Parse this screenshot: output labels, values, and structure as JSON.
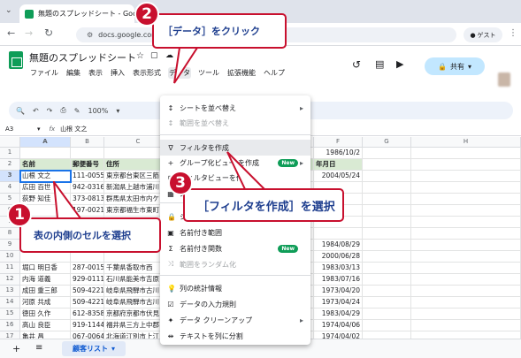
{
  "browser": {
    "tab_title": "無題のスプレッドシート - Google スプ",
    "url": "docs.google.com/sprea",
    "guest": "ゲスト"
  },
  "doc": {
    "title": "無題のスプレッドシート",
    "menus": [
      "ファイル",
      "編集",
      "表示",
      "挿入",
      "表示形式",
      "データ",
      "ツール",
      "拡張機能",
      "ヘルプ"
    ],
    "share": "共有"
  },
  "toolbar": {
    "zoom": "100%"
  },
  "formula": {
    "cellref": "A3",
    "fx": "fx",
    "value": "山根 文之"
  },
  "grid": {
    "columns": [
      "A",
      "B",
      "C",
      "D",
      "E",
      "F",
      "G",
      "H"
    ],
    "rows": [
      "1",
      "2",
      "3",
      "4",
      "5",
      "6",
      "7",
      "8",
      "9",
      "10",
      "11",
      "12",
      "13",
      "14",
      "15",
      "16",
      "17",
      "18"
    ],
    "headers": {
      "name": "名前",
      "zip": "郵便番号",
      "address": "住所",
      "birth": "生年月日"
    },
    "data": [
      {
        "name": "山根 文之",
        "zip": "111-0055",
        "address": "東京都台東区三筋",
        "birth": "2004/05/24"
      },
      {
        "name": "広田 百世",
        "zip": "942-0316",
        "address": "新潟県上越市浦川",
        "birth": ""
      },
      {
        "name": "荻野 知佳",
        "zip": "373-0813",
        "address": "群馬県太田市内ケ",
        "birth": ""
      },
      {
        "name": "歩",
        "zip": "197-0021",
        "address": "東京都福生市東町",
        "birth": ""
      },
      {
        "name": "",
        "zip": "",
        "address": "",
        "birth": ""
      },
      {
        "name": "",
        "zip": "",
        "address": "",
        "birth": ""
      },
      {
        "name": "",
        "zip": "",
        "address": "",
        "birth": "1984/08/29"
      },
      {
        "name": "",
        "zip": "",
        "address": "",
        "birth": "2000/06/28"
      },
      {
        "name": "堀口 明日香",
        "zip": "287-0015",
        "address": "千葉県香取市西",
        "birth": "1983/03/13"
      },
      {
        "name": "内海 道義",
        "zip": "929-0111",
        "address": "石川県能美市吉原",
        "birth": "1983/07/16"
      },
      {
        "name": "成田 重三郎",
        "zip": "509-4221",
        "address": "岐阜県飛騨市古川",
        "birth": "1973/04/20"
      },
      {
        "name": "河原 共成",
        "zip": "509-4221",
        "address": "岐阜県飛騨市古川",
        "birth": "1973/04/24"
      },
      {
        "name": "徳田 久作",
        "zip": "612-8358",
        "address": "京都府京都市伏見",
        "birth": "1983/04/29"
      },
      {
        "name": "高山 良臣",
        "zip": "919-1144",
        "address": "福井県三方上中郡",
        "birth": "1974/04/06"
      },
      {
        "name": "亀井 昌",
        "zip": "067-0064",
        "address": "北海道江別市上江",
        "birth": "1974/04/02"
      }
    ],
    "birth_partial_top": "1986/10/2",
    "birth_partial_header": "年月日"
  },
  "sheetbar": {
    "sheet_name": "顧客リスト"
  },
  "menu": {
    "items": [
      {
        "label": "シートを並べ替え",
        "icon": "sort",
        "arrow": true,
        "disabled": false
      },
      {
        "label": "範囲を並べ替え",
        "icon": "sort",
        "arrow": false,
        "disabled": true
      },
      {
        "label": "フィルタを作成",
        "icon": "filter",
        "arrow": false,
        "disabled": false
      },
      {
        "label": "グループ化ビュー を作成",
        "icon": "plus",
        "arrow": true,
        "disabled": false,
        "badge": "New"
      },
      {
        "label": "フィルタビューを作成",
        "icon": "filter-view",
        "arrow": false,
        "disabled": false
      },
      {
        "label": "スライサー",
        "icon": "slicer",
        "arrow": false,
        "disabled": false
      },
      {
        "label": "シートと範囲を保護",
        "icon": "lock",
        "arrow": false,
        "disabled": false
      },
      {
        "label": "名前付き範囲",
        "icon": "named",
        "arrow": false,
        "disabled": false
      },
      {
        "label": "名前付き関数",
        "icon": "sigma",
        "arrow": false,
        "disabled": false,
        "badge": "New"
      },
      {
        "label": "範囲をランダム化",
        "icon": "shuffle",
        "arrow": false,
        "disabled": true
      },
      {
        "label": "列の統計情報",
        "icon": "bulb",
        "arrow": false,
        "disabled": false
      },
      {
        "label": "データの入力規則",
        "icon": "validation",
        "arrow": false,
        "disabled": false
      },
      {
        "label": "データ クリーンアップ",
        "icon": "wand",
        "arrow": true,
        "disabled": false
      },
      {
        "label": "テキストを列に分割",
        "icon": "split",
        "arrow": false,
        "disabled": false
      }
    ]
  },
  "callouts": {
    "c1_num": "1",
    "c1_text": "表の内側のセルを選択",
    "c2_num": "2",
    "c2_text": "［データ］をクリック",
    "c3_num": "3",
    "c3_text": "［フィルタを作成］を選択"
  },
  "colors": {
    "accent": "#c8102e",
    "callout_text": "#1f3f8f",
    "header_fill": "#d9ead3"
  }
}
